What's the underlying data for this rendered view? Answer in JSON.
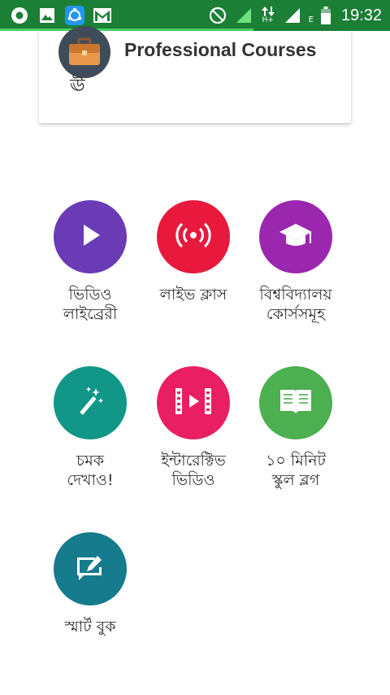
{
  "status_bar": {
    "time": "19:32",
    "network_label": "H+",
    "network_label_2": "E",
    "icons": [
      "record-icon",
      "gallery-icon",
      "sync-icon",
      "gmail-icon",
      "no-disturb-icon",
      "signal-icon",
      "data-arrows-icon",
      "signal-icon-2",
      "battery-icon"
    ],
    "progress_fraction": 0.65
  },
  "card": {
    "title": "Professional Courses",
    "icon": "briefcase-icon",
    "glyph": "ঊ"
  },
  "tiles": [
    {
      "label": "ভিডিও\nলাইব্রেরী",
      "icon": "play-icon",
      "color": "#6a3bb5"
    },
    {
      "label": "লাইভ ক্লাস",
      "icon": "live-broadcast-icon",
      "color": "#e8193d"
    },
    {
      "label": "বিশ্ববিদ্যালয়\nকোর্সসমূহ",
      "icon": "graduation-cap-icon",
      "color": "#9b27af"
    },
    {
      "label": "চমক\nদেখাও!",
      "icon": "magic-wand-icon",
      "color": "#119688"
    },
    {
      "label": "ইন্টারেক্টিভ\nভিডিও",
      "icon": "interactive-video-icon",
      "color": "#e91e63"
    },
    {
      "label": "১০ মিনিট\nস্কুল ব্লগ",
      "icon": "open-book-icon",
      "color": "#4caf50"
    },
    {
      "label": "স্মার্ট বুক",
      "icon": "edit-note-icon",
      "color": "#167b8d"
    }
  ]
}
